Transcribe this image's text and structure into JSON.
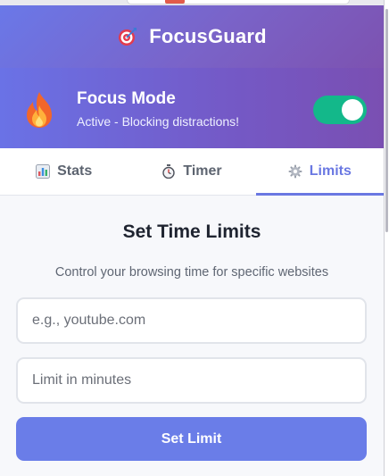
{
  "header": {
    "app_name": "FocusGuard",
    "icon": "target-dart-icon"
  },
  "focus_mode": {
    "title": "Focus Mode",
    "status": "Active - Blocking distractions!",
    "icon": "fire-icon",
    "enabled": true
  },
  "tabs": [
    {
      "label": "Stats",
      "icon": "bar-chart-icon",
      "active": false
    },
    {
      "label": "Timer",
      "icon": "stopwatch-icon",
      "active": false
    },
    {
      "label": "Limits",
      "icon": "gear-icon",
      "active": true
    }
  ],
  "limits": {
    "title": "Set Time Limits",
    "description": "Control your browsing time for specific websites",
    "site_placeholder": "e.g., youtube.com",
    "site_value": "",
    "minutes_placeholder": "Limit in minutes",
    "minutes_value": "",
    "submit_label": "Set Limit"
  },
  "colors": {
    "accent": "#6a78e2",
    "toggle_on": "#13b88a",
    "header_gradient_start": "#6a78e8",
    "header_gradient_end": "#7d52b0"
  }
}
